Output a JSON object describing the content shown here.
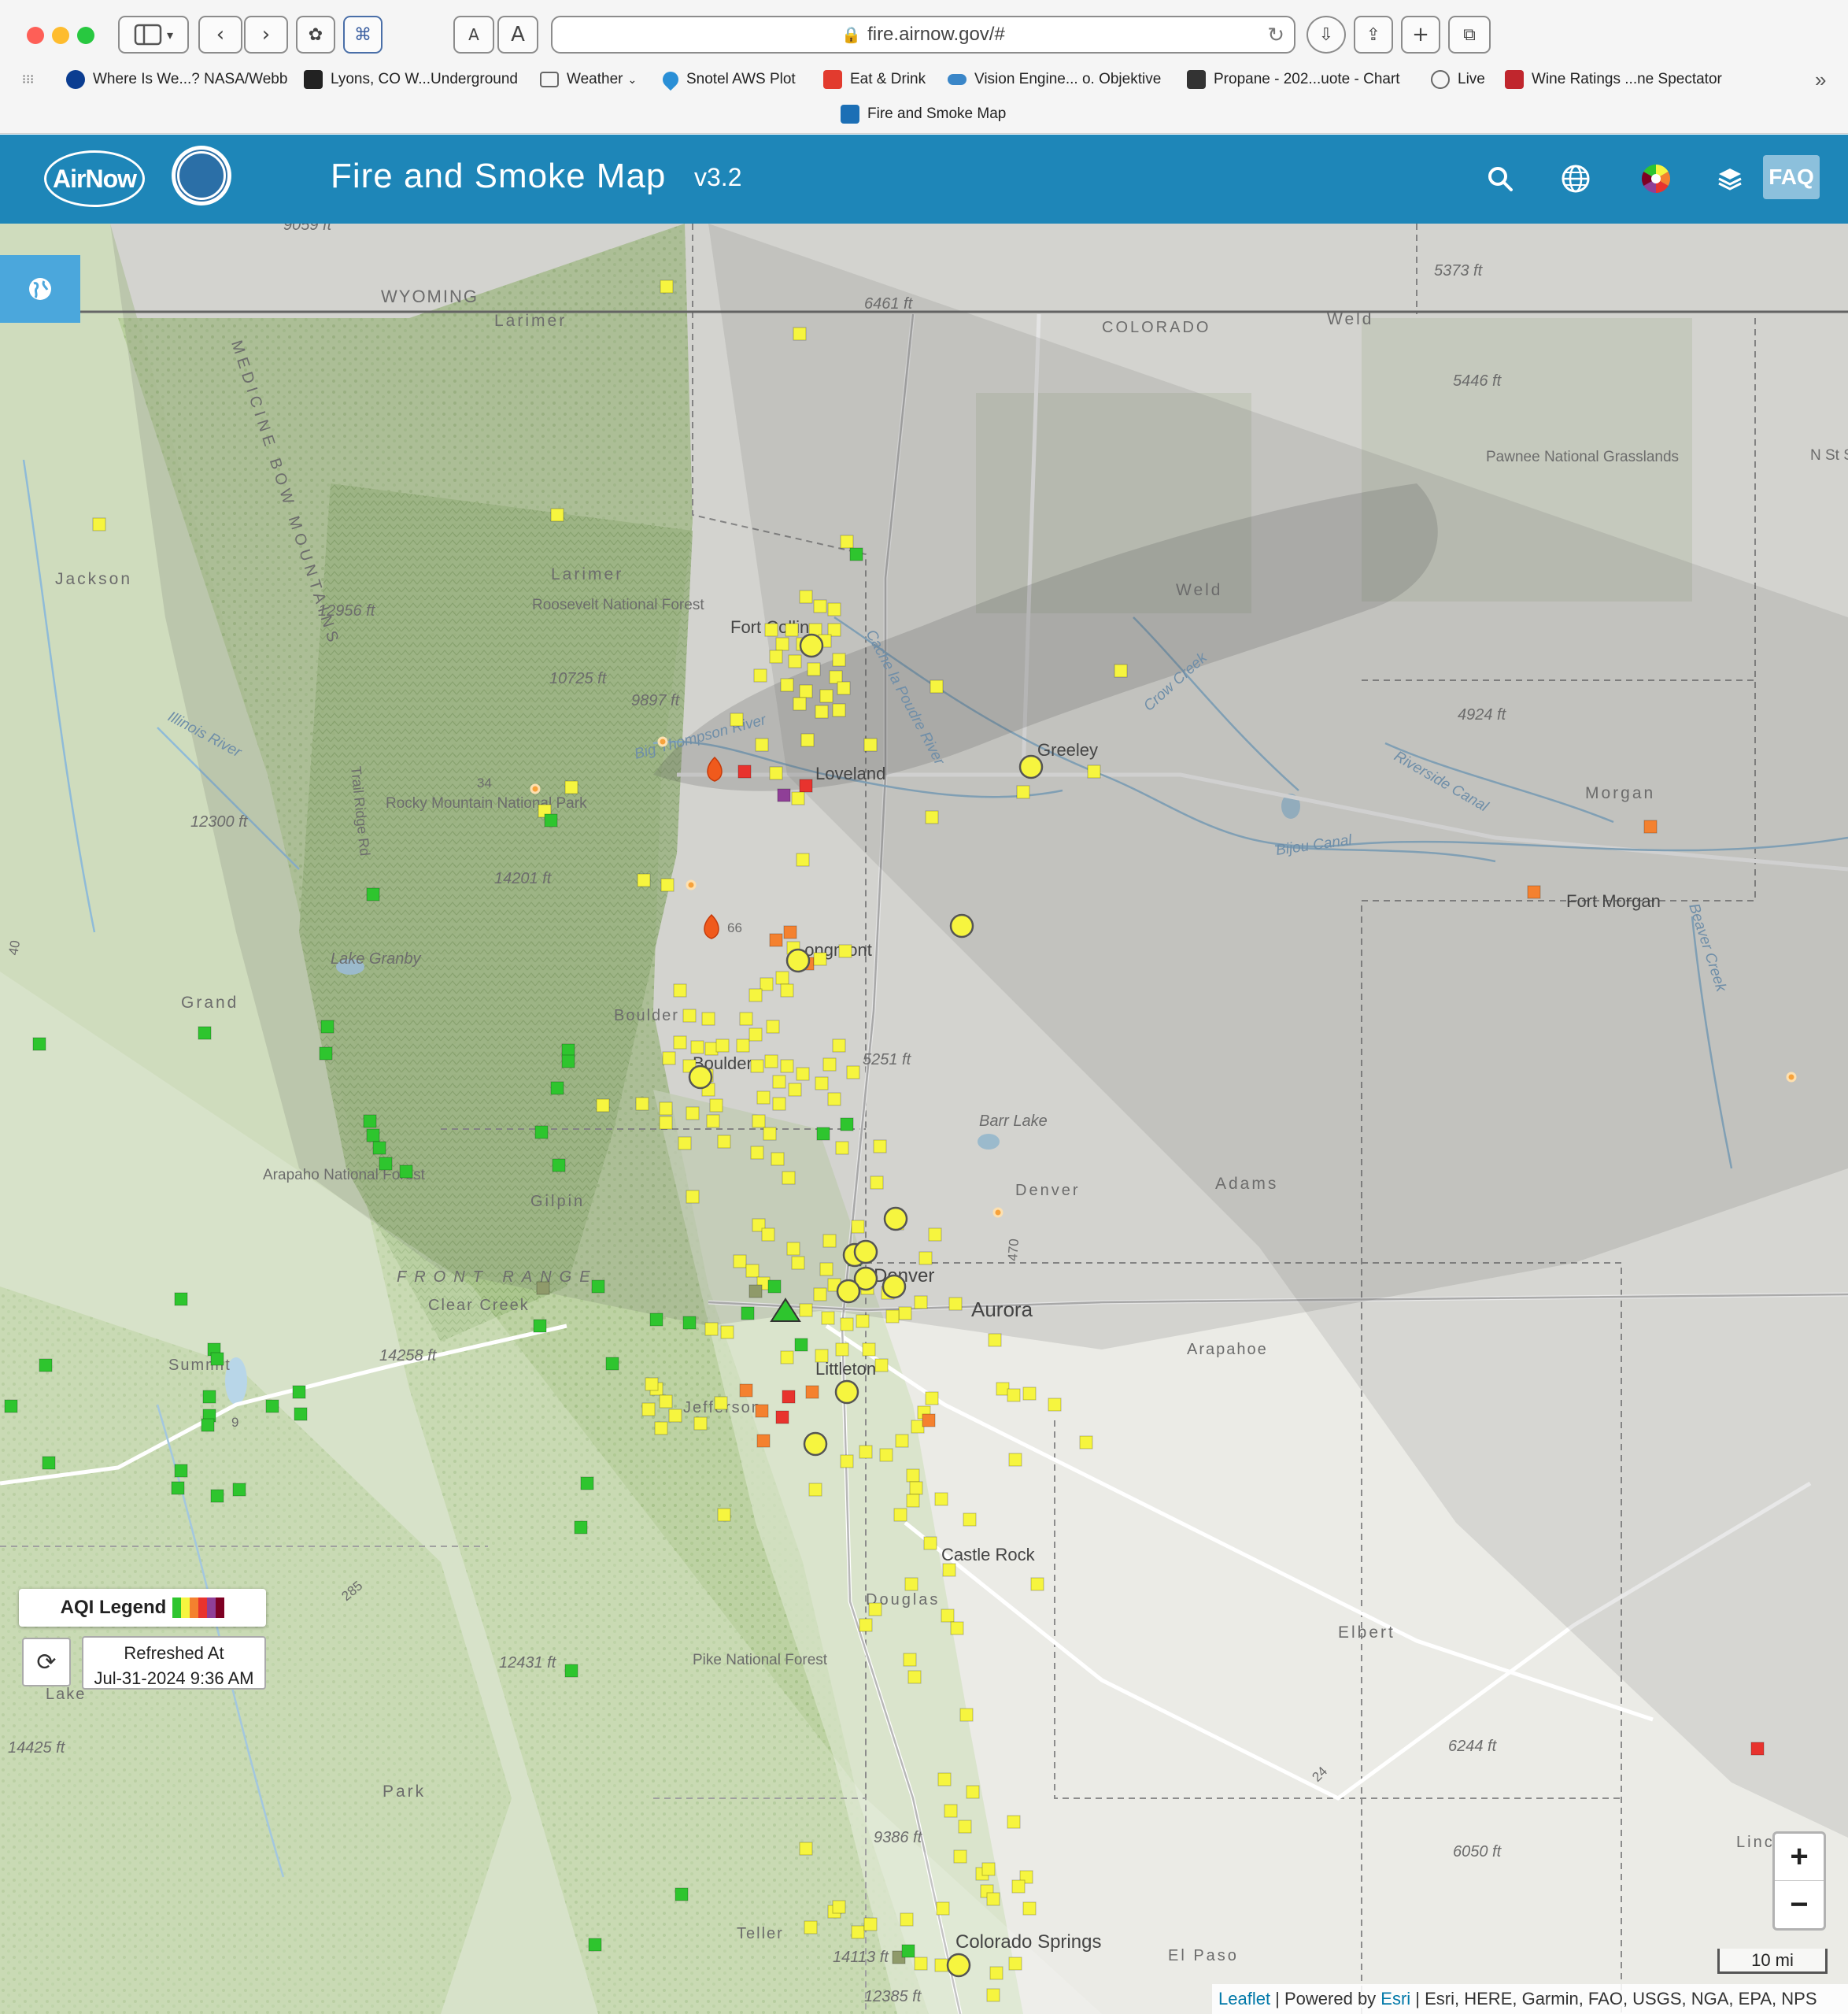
{
  "browser": {
    "url": "fire.airnow.gov/#",
    "text_size_small": "A",
    "text_size_large": "A",
    "bookmarks": [
      {
        "label": "Where Is We...? NASA/Webb",
        "color": "#0b3d91"
      },
      {
        "label": "Lyons, CO W...Underground",
        "color": "#222222"
      },
      {
        "label": "Weather",
        "color": "#666666"
      },
      {
        "label": "Snotel AWS Plot",
        "color": "#2a8fd6"
      },
      {
        "label": "Eat & Drink",
        "color": "#e23b2e"
      },
      {
        "label": "Vision Engine... o. Objektive",
        "color": "#3a86c8"
      },
      {
        "label": "Propane - 202...uote - Chart",
        "color": "#333333"
      },
      {
        "label": "Live",
        "color": "#666666"
      },
      {
        "label": "Wine Ratings ...ne Spectator",
        "color": "#c0262d"
      }
    ],
    "bookmark_second_row": "Fire and Smoke Map",
    "more_bookmarks_icon": "chevron-double-right-icon"
  },
  "header": {
    "logo_text": "AirNow",
    "title": "Fire and Smoke Map",
    "version": "v3.2",
    "faq_label": "FAQ",
    "bg_color": "#1e86b8"
  },
  "map": {
    "labels": {
      "wyoming": "WYOMING",
      "colorado": "COLORADO",
      "larimer_top": "Larimer",
      "larimer": "Larimer",
      "weld_top": "Weld",
      "weld": "Weld",
      "jackson": "Jackson",
      "medicine_bow": "MEDICINE BOW MOUNTAINS",
      "roosevelt": "Roosevelt National Forest",
      "fort_collins": "Fort Collins",
      "loveland": "Loveland",
      "greeley": "Greeley",
      "rmnp": "Rocky Mountain National Park",
      "longmont": "Longmont",
      "boulder_county": "Boulder",
      "boulder": "Boulder",
      "pawnee": "Pawnee National Grasslands",
      "morgan": "Morgan",
      "fort_morgan": "Fort Morgan",
      "grand": "Grand",
      "lake_granby": "Lake Granby",
      "arapaho": "Arapaho National Forest",
      "gilpin": "Gilpin",
      "front_range": "FRONT RANGE",
      "clear_creek": "Clear Creek",
      "denver_county": "Denver",
      "denver": "Denver",
      "aurora": "Aurora",
      "adams": "Adams",
      "arapahoe": "Arapahoe",
      "barr_lake": "Barr Lake",
      "littleton": "Littleton",
      "jefferson": "Jefferson",
      "summit": "Summit",
      "castle_rock": "Castle Rock",
      "douglas": "Douglas",
      "elbert": "Elbert",
      "pike": "Pike National Forest",
      "park": "Park",
      "lake": "Lake",
      "teller": "Teller",
      "el_paso": "El Paso",
      "colorado_springs": "Colorado Springs",
      "linc": "Linc",
      "cache_la_poudre": "Cache la Poudre River",
      "big_thompson": "Big Thompson River",
      "crow_creek": "Crow Creek",
      "riverside_canal": "Riverside Canal",
      "bijou_canal": "Bijou Canal",
      "beaver_creek": "Beaver Creek",
      "illinois_river": "Illinois River",
      "trail_ridge": "Trail Ridge Rd",
      "hwy_34": "34",
      "hwy_66": "66",
      "hwy_40": "40",
      "hwy_470": "470",
      "hwy_285": "285",
      "hwy_24": "24",
      "hwy_9": "9",
      "ns_state": "N St Stat"
    },
    "elevations": {
      "e9059": "9059 ft",
      "e6461": "6461 ft",
      "e5373": "5373 ft",
      "e5446": "5446 ft",
      "e12956": "12956 ft",
      "e10725": "10725 ft",
      "e9897": "9897 ft",
      "e4924": "4924 ft",
      "e12300": "12300 ft",
      "e14201": "14201 ft",
      "e5251": "5251 ft",
      "e14258": "14258 ft",
      "e12431": "12431 ft",
      "e14425": "14425 ft",
      "e6244": "6244 ft",
      "e9386": "9386 ft",
      "e6050": "6050 ft",
      "e14113": "14113 ft",
      "e12385": "12385 ft"
    },
    "aqi_colors": {
      "good": "#2ec52e",
      "moderate": "#f6f53f",
      "usg": "#f4812f",
      "unhealthy": "#e8332e",
      "very_unhealthy": "#8f3f97",
      "hazardous": "#7e0023"
    },
    "scale_label": "10 mi",
    "attribution": {
      "leaflet": "Leaflet",
      "powered_by": " | Powered by ",
      "esri": "Esri",
      "sources": " | Esri, HERE, Garmin, FAO, USGS, NGA, EPA, NPS"
    },
    "zoom_in": "+",
    "zoom_out": "−"
  },
  "legend": {
    "aqi_label": "AQI Legend",
    "refreshed_label": "Refreshed At",
    "refreshed_time": "Jul-31-2024 9:36 AM"
  }
}
